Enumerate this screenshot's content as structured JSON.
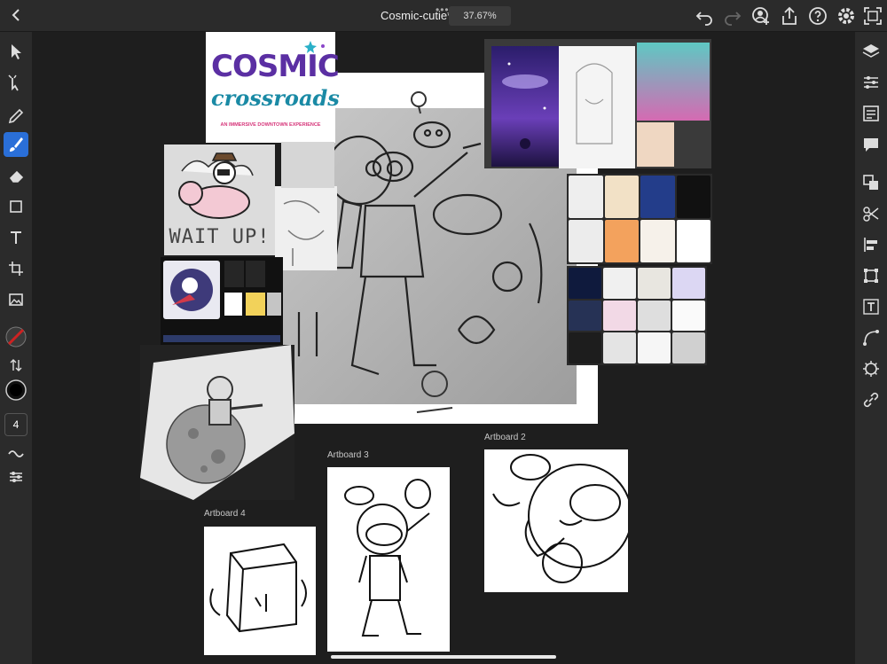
{
  "app": {
    "document_title": "Cosmic-cutie*",
    "zoom": "37.67%"
  },
  "toolbar_right": [
    "undo-icon",
    "redo-icon",
    "user-add-icon",
    "share-icon",
    "help-icon",
    "settings-icon",
    "fullscreen-icon"
  ],
  "left_tools": {
    "items": [
      "select-icon",
      "direct-select-icon",
      "pen-icon",
      "brush-icon",
      "eraser-icon",
      "rectangle-icon",
      "text-icon",
      "crop-icon",
      "image-icon",
      "color-swatch-icon",
      "swap-icon",
      "brush-preset-icon",
      "smooth-icon",
      "properties-icon"
    ],
    "brush_size": "4",
    "active_color": "#cc2222"
  },
  "right_tools": [
    "layers-icon",
    "adjust-icon",
    "libraries-icon",
    "comments-icon",
    "arrange-icon",
    "shape-builder-icon",
    "align-icon",
    "transform-icon",
    "type-icon",
    "path-icon",
    "symbol-icon",
    "link-icon"
  ],
  "canvas": {
    "poster": {
      "title_line1": "COSMIC",
      "title_line2": "crossroads",
      "subtitle": "AN IMMERSIVE DOWNTOWN EXPERIENCE"
    },
    "pig_sticker": {
      "caption": "WAIT UP!"
    },
    "artboards": [
      {
        "label": "Artboard 2"
      },
      {
        "label": "Artboard 3"
      },
      {
        "label": "Artboard 4"
      }
    ]
  },
  "colors": {
    "accent": "#2a6fd8",
    "canvas_bg": "#1e1e1e",
    "panel_bg": "#2b2b2b"
  }
}
